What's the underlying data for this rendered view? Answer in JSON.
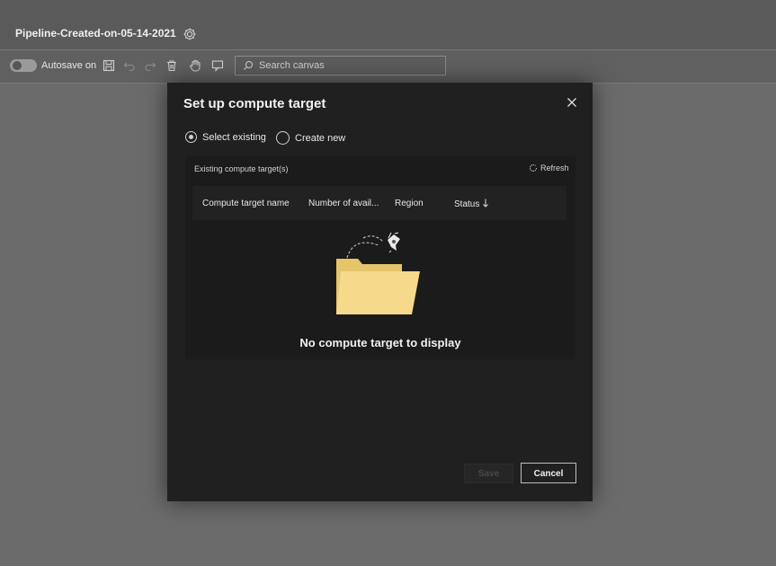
{
  "app": {
    "pipeline_title": "Pipeline-Created-on-05-14-2021",
    "autosave_label": "Autosave on",
    "autosave_enabled": true,
    "search": {
      "placeholder": "Search canvas",
      "value": ""
    },
    "toolbar_icons": [
      "settings-icon",
      "save-icon",
      "undo-icon",
      "redo-icon",
      "delete-icon",
      "pan-hand-icon",
      "comment-icon"
    ]
  },
  "modal": {
    "title": "Set up compute target",
    "options": [
      {
        "label": "Select existing",
        "selected": true
      },
      {
        "label": "Create new",
        "selected": false
      }
    ],
    "section_label": "Existing compute target(s)",
    "refresh_label": "Refresh",
    "columns": [
      "Compute target name",
      "Number of avail...",
      "Region",
      "Status"
    ],
    "sort_indicator": "descending",
    "empty_message": "No compute target to display",
    "buttons": {
      "save": "Save",
      "cancel": "Cancel"
    },
    "save_enabled": false
  },
  "colors": {
    "modal_background": "#202020",
    "panel_background": "#1b1b1b",
    "folder_yellow": "#f2d27a",
    "overlay": "#6b6b6b"
  }
}
